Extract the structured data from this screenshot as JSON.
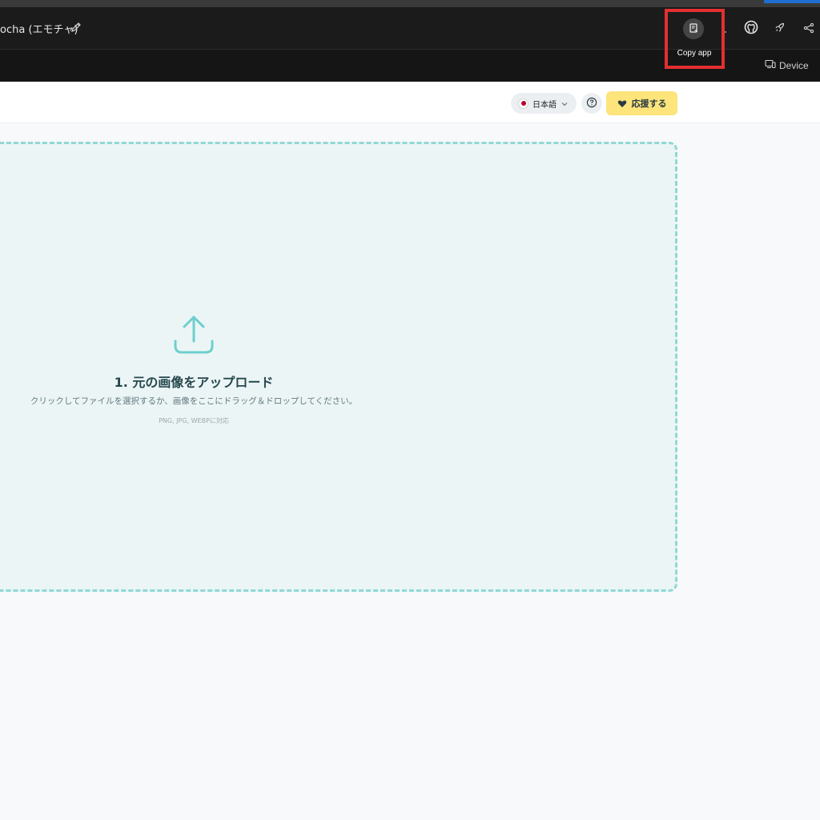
{
  "window": {
    "title": "ocha (エモチャ)"
  },
  "toolbar": {
    "copy_tooltip": "Copy app",
    "device_label": "Device",
    "icons": [
      "copy-app-icon",
      "download-icon",
      "github-icon",
      "rocket-icon",
      "share-icon",
      "pencil-icon",
      "device-icon"
    ]
  },
  "header": {
    "language": "日本語",
    "support_label": "応援する"
  },
  "upload": {
    "title": "1. 元の画像をアップロード",
    "description": "クリックしてファイルを選択するか、画像をここにドラッグ＆ドロップしてください。",
    "formats": "PNG, JPG, WEBPに対応"
  },
  "colors": {
    "titlebar_bg": "#1b1b1b",
    "highlight": "#e23030",
    "dropzone_border": "#8fd8d6",
    "dropzone_bg": "#ecf5f6",
    "support_bg": "#fde47b",
    "upload_icon": "#6dcfcc"
  }
}
